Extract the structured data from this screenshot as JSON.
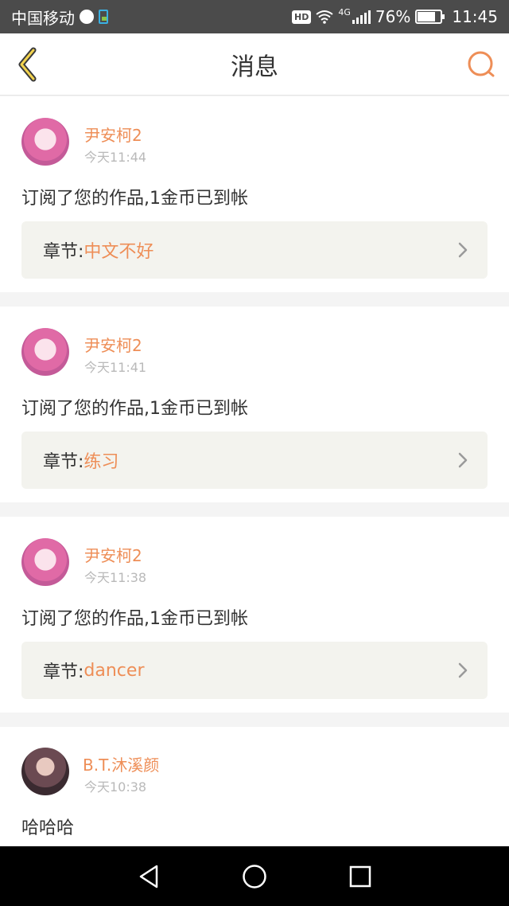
{
  "status_bar": {
    "carrier": "中国移动",
    "network": "4G",
    "battery": "76%",
    "battery_level": 0.76,
    "time": "11:45",
    "hd_label": "HD"
  },
  "header": {
    "title": "消息",
    "back_icon": "chevron-left-icon",
    "search_icon": "search-icon",
    "accent_color": "#ee8e57"
  },
  "messages": [
    {
      "username": "尹安柯2",
      "time": "今天11:44",
      "text": "订阅了您的作品,1金币已到帐",
      "chapter_label": "章节:",
      "chapter_name": "中文不好"
    },
    {
      "username": "尹安柯2",
      "time": "今天11:41",
      "text": "订阅了您的作品,1金币已到帐",
      "chapter_label": "章节:",
      "chapter_name": "练习"
    },
    {
      "username": "尹安柯2",
      "time": "今天11:38",
      "text": "订阅了您的作品,1金币已到帐",
      "chapter_label": "章节:",
      "chapter_name": "dancer"
    },
    {
      "username": "B.T.沐溪颜",
      "time": "今天10:38",
      "text": "哈哈哈"
    }
  ],
  "nav_bar": {
    "back_icon": "triangle-back-icon",
    "home_icon": "circle-home-icon",
    "recents_icon": "square-recents-icon"
  }
}
